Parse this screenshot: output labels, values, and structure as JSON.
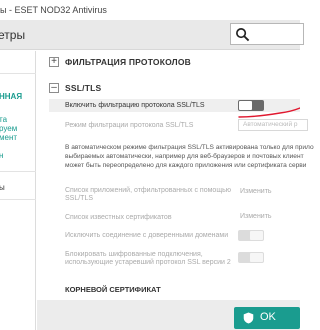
{
  "window": {
    "title": "ы - ESET NOD32 Antivirus"
  },
  "toolbar": {
    "title": "етры",
    "search_icon": "search-icon"
  },
  "sidebar": {
    "items": [
      {
        "label": "ННАЯ",
        "style": "teal-bold"
      },
      {
        "label": "та",
        "style": "teal"
      },
      {
        "label": "руем",
        "style": "teal"
      },
      {
        "label": "мент",
        "style": "teal"
      },
      {
        "label": "н",
        "style": "teal"
      },
      {
        "label": "ы",
        "style": "dark"
      }
    ]
  },
  "sections": {
    "protocol_filtering": {
      "title": "ФИЛЬТРАЦИЯ ПРОТОКОЛОВ",
      "state": "collapsed",
      "toggle_symbol": "+"
    },
    "ssl_tls": {
      "title": "SSL/TLS",
      "state": "expanded",
      "toggle_symbol": "–"
    }
  },
  "ssl": {
    "enable_label": "Включить фильтрацию протокола SSL/TLS",
    "enable_state": "off",
    "mode_label": "Режим фильтрации протокола SSL/TLS",
    "mode_value": "Автоматический р",
    "info_lines": [
      "В автоматическом режиме фильтрация SSL/TLS активирована только для прило",
      "выбираемых автоматически, например для веб-браузеров и почтовых клиент",
      "может быть переопределено для каждого приложения или сертификата серви"
    ],
    "apps_list_label_1": "Список приложений, отфильтрованных с помощью",
    "apps_list_label_2": "SSL/TLS",
    "apps_list_action": "Изменить",
    "known_certs_label": "Список известных сертификатов",
    "known_certs_action": "Изменить",
    "exclude_trusted_label": "Исключить соединение с доверенными доменами",
    "block_ssl2_label_1": "Блокировать шифрованные подключения,",
    "block_ssl2_label_2": "использующие устаревший протокол SSL версии 2",
    "root_cert_title": "КОРНЕВОЙ СЕРТИФИКАТ"
  },
  "footer": {
    "ok_label": "OK",
    "ok_icon": "shield-icon"
  },
  "colors": {
    "accent": "#1a9c8f",
    "annotation": "#e0182f",
    "toolbar_bg": "#e9e9e9"
  }
}
